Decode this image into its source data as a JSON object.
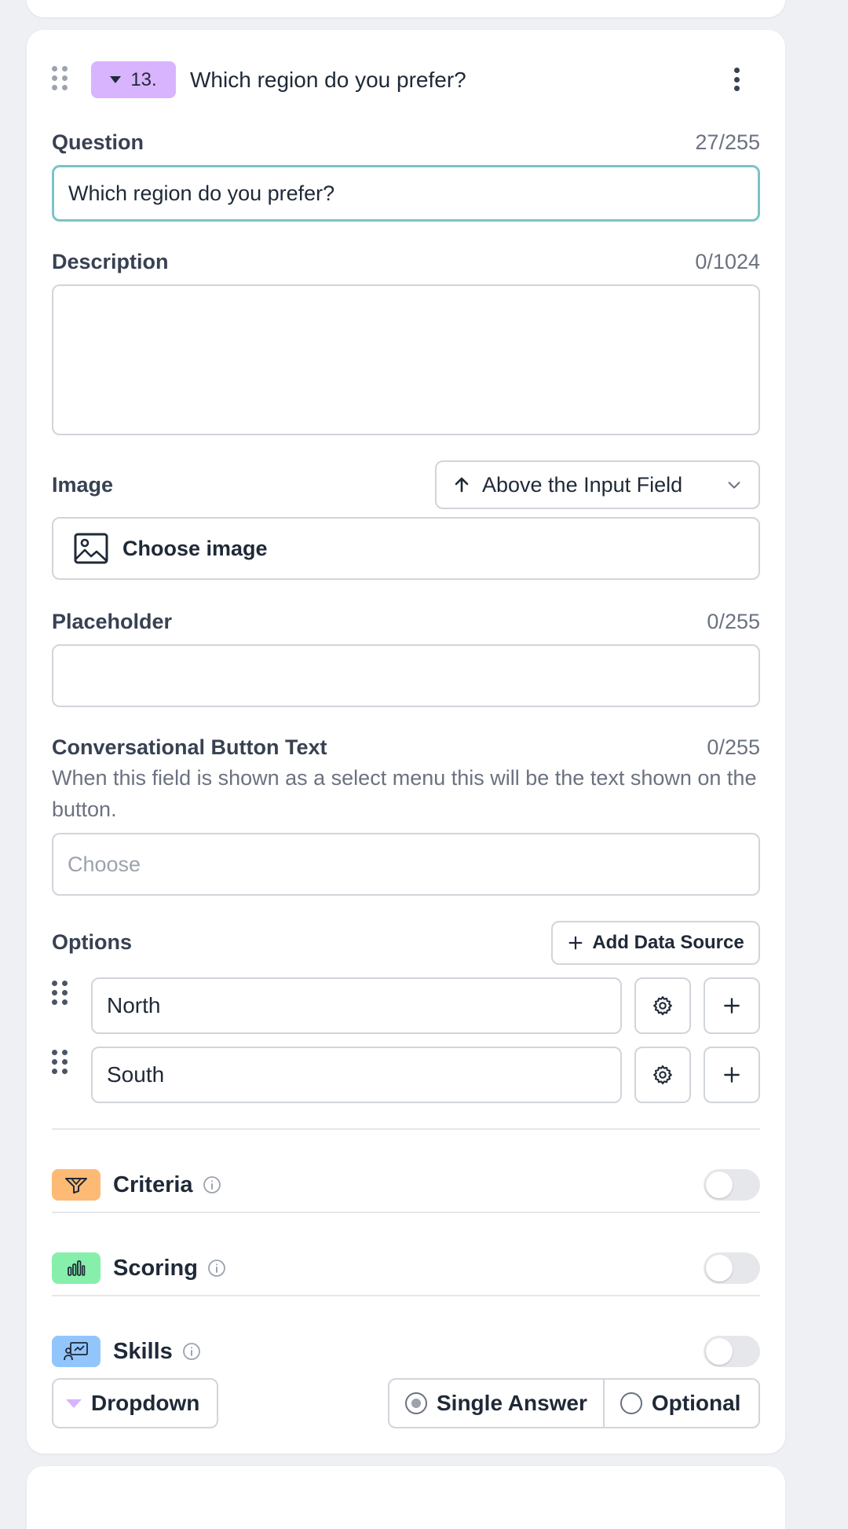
{
  "question_card": {
    "number_label": "13.",
    "title": "Which region do you prefer?",
    "question": {
      "label": "Question",
      "counter": "27/255",
      "value": "Which region do you prefer?"
    },
    "description": {
      "label": "Description",
      "counter": "0/1024",
      "value": ""
    },
    "image": {
      "label": "Image",
      "position_select": "Above the Input Field",
      "choose_label": "Choose image"
    },
    "placeholder": {
      "label": "Placeholder",
      "counter": "0/255",
      "value": ""
    },
    "conversational": {
      "label": "Conversational Button Text",
      "counter": "0/255",
      "helper": "When this field is shown as a select menu this will be the text shown on the button.",
      "placeholder": "Choose"
    },
    "options": {
      "label": "Options",
      "add_data_source": "Add Data Source",
      "items": [
        "North",
        "South"
      ]
    },
    "features": [
      {
        "label": "Criteria",
        "icon": "funnel-icon",
        "color": "#fdba74",
        "enabled": false
      },
      {
        "label": "Scoring",
        "icon": "bar-chart-icon",
        "color": "#86efac",
        "enabled": false
      },
      {
        "label": "Skills",
        "icon": "presentation-icon",
        "color": "#93c5fd",
        "enabled": false
      }
    ],
    "footer": {
      "type_label": "Dropdown",
      "single_answer": "Single Answer",
      "optional": "Optional"
    }
  },
  "colors": {
    "badge": "#d8b4fe",
    "focus_border": "#7cc3c8",
    "criteria": "#fdba74",
    "scoring": "#86efac",
    "skills": "#93c5fd"
  }
}
